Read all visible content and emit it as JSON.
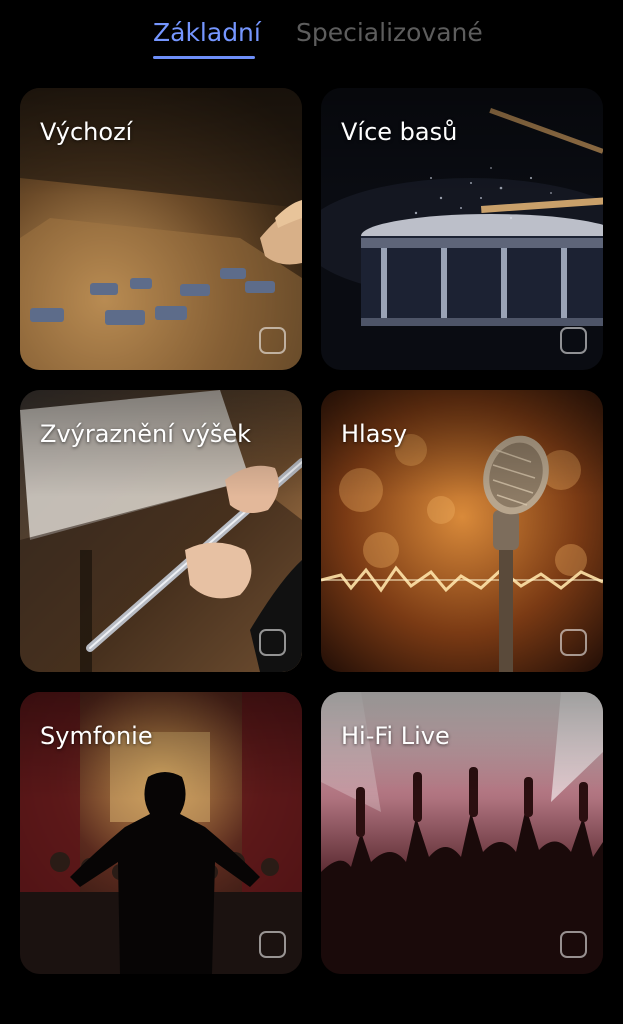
{
  "tabs": {
    "basic": "Základní",
    "specialized": "Specializované",
    "active": "basic"
  },
  "accent_color": "#6e8ff9",
  "presets": [
    {
      "id": "default",
      "title": "Výchozí",
      "image": "mixing-console-image",
      "selected": false
    },
    {
      "id": "bass",
      "title": "Více basů",
      "image": "snare-drum-image",
      "selected": false
    },
    {
      "id": "treble",
      "title": "Zvýraznění výšek",
      "image": "flute-player-image",
      "selected": false
    },
    {
      "id": "vocals",
      "title": "Hlasy",
      "image": "microphone-image",
      "selected": false
    },
    {
      "id": "symphony",
      "title": "Symfonie",
      "image": "orchestra-conductor-image",
      "selected": false
    },
    {
      "id": "hifi-live",
      "title": "Hi-Fi Live",
      "image": "concert-crowd-image",
      "selected": false
    }
  ]
}
